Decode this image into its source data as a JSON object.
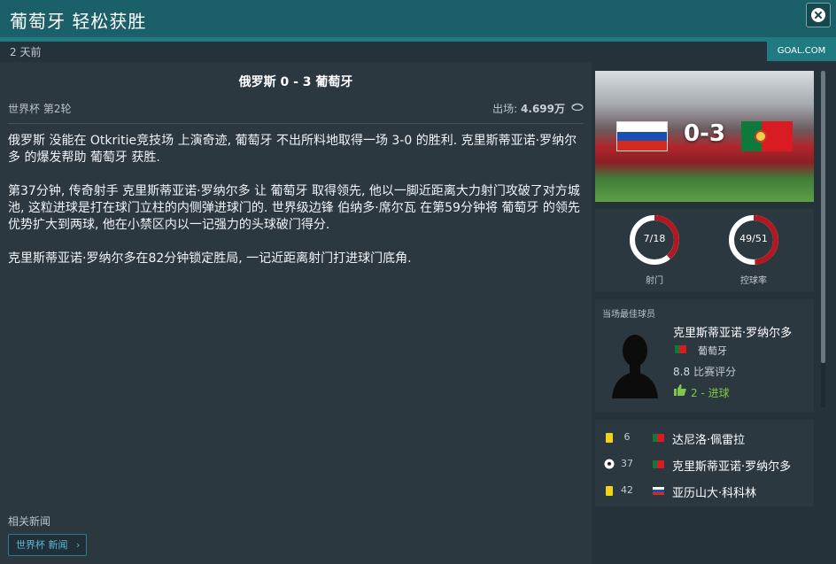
{
  "header": {
    "title": "葡萄牙 轻松获胜",
    "close_icon": "close-icon"
  },
  "meta": {
    "time_ago": "2 天前",
    "source": "GOAL.COM"
  },
  "article": {
    "match_title": "俄罗斯 0 - 3 葡萄牙",
    "competition": "世界杯 第2轮",
    "attendance_label": "出场:",
    "attendance_value": "4.699万",
    "paragraphs": [
      "俄罗斯 没能在 Otkritie竞技场 上演奇迹, 葡萄牙 不出所料地取得一场 3-0 的胜利. 克里斯蒂亚诺·罗纳尔多 的爆发帮助 葡萄牙 获胜.",
      "第37分钟, 传奇射手 克里斯蒂亚诺·罗纳尔多 让 葡萄牙 取得领先, 他以一脚近距离大力射门攻破了对方城池, 这粒进球是打在球门立柱的内侧弹进球门的. 世界级边锋 伯纳多·席尔瓦 在第59分钟将 葡萄牙 的领先优势扩大到两球, 他在小禁区内以一记强力的头球破门得分.",
      "克里斯蒂亚诺·罗纳尔多在82分钟锁定胜局, 一记近距离射门打进球门底角."
    ],
    "related_label": "相关新闻",
    "related_button": "世界杯 新闻"
  },
  "scorecard": {
    "score": "0-3",
    "home_flag": "russia-flag",
    "away_flag": "portugal-flag"
  },
  "stats": [
    {
      "label": "7/18",
      "caption": "射门",
      "fraction": 0.39
    },
    {
      "label": "49/51",
      "caption": "控球率",
      "fraction": 0.49
    }
  ],
  "colors": {
    "ring_fill": "#b3181e",
    "ring_track": "#ffffff",
    "header_bg": "#1b5f68",
    "accent": "#1f7a82"
  },
  "mvp": {
    "header": "当场最佳球员",
    "name": "克里斯蒂亚诺·罗纳尔多",
    "team": "葡萄牙",
    "rating_value": "8.8",
    "rating_label": "比赛评分",
    "goals": "2 - 进球"
  },
  "events": [
    {
      "type": "yellow-card",
      "minute": "6",
      "team": "portugal",
      "player": "达尼洛·佩雷拉"
    },
    {
      "type": "goal",
      "minute": "37",
      "team": "portugal",
      "player": "克里斯蒂亚诺·罗纳尔多"
    },
    {
      "type": "yellow-card",
      "minute": "42",
      "team": "russia",
      "player": "亚历山大·科科林"
    }
  ]
}
